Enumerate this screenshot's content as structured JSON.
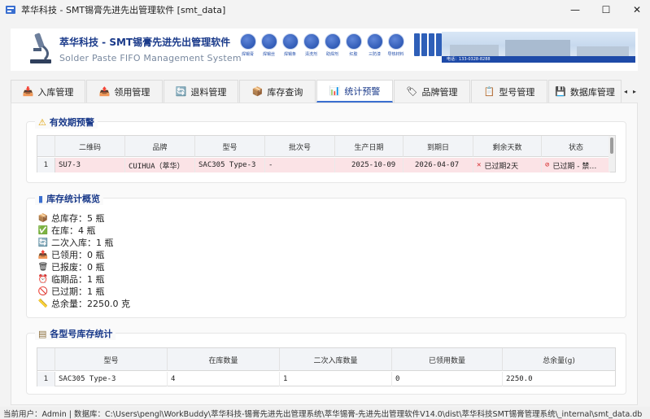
{
  "window": {
    "title": "萃华科技 - SMT锡膏先进先出管理软件 [smt_data]",
    "controls": {
      "minimize": "—",
      "maximize": "☐",
      "close": "✕"
    }
  },
  "header": {
    "title_cn": "萃华科技 - SMT锡膏先进先出管理软件",
    "title_en": "Solder Paste FIFO Management System",
    "products": [
      "焊锡膏",
      "焊锡丝",
      "焊锡条",
      "清洗剂",
      "助焊剂",
      "红胶",
      "三防漆",
      "导热材料"
    ],
    "ribbon_text": "电话：133-0328-8288"
  },
  "tabs": [
    {
      "label": "入库管理",
      "icon": "inbound-icon",
      "glyph": "📥"
    },
    {
      "label": "领用管理",
      "icon": "outbound-icon",
      "glyph": "📤"
    },
    {
      "label": "退料管理",
      "icon": "return-icon",
      "glyph": "🔄"
    },
    {
      "label": "库存查询",
      "icon": "box-icon",
      "glyph": "📦"
    },
    {
      "label": "统计预警",
      "icon": "chart-icon",
      "glyph": "📊"
    },
    {
      "label": "品牌管理",
      "icon": "tag-icon",
      "glyph": "🏷"
    },
    {
      "label": "型号管理",
      "icon": "document-icon",
      "glyph": "📋"
    },
    {
      "label": "数据库管理",
      "icon": "database-icon",
      "glyph": "💾"
    }
  ],
  "tab_scroll": {
    "left": "◂",
    "right": "▸"
  },
  "expiry_warning": {
    "title": "有效期预警",
    "icon": "warning-icon",
    "columns": [
      "二维码",
      "品牌",
      "型号",
      "批次号",
      "生产日期",
      "到期日",
      "剩余天数",
      "状态"
    ],
    "rows": [
      {
        "index": "1",
        "qrcode": "SU7-3",
        "brand": "CUIHUA（萃华）",
        "model": "SAC305 Type-3",
        "batch": "-",
        "production_date": "2025-10-09",
        "expiry_date": "2026-04-07",
        "remaining_days": "已过期2天",
        "remaining_icon": "x-icon",
        "status": "已过期 - 禁…",
        "status_icon": "prohibited-icon"
      }
    ]
  },
  "inventory_overview": {
    "title": "库存统计概览",
    "icon": "bar-chart-icon",
    "stats": [
      {
        "label": "总库存：5 瓶",
        "icon": "box-icon",
        "glyph": "📦"
      },
      {
        "label": "在库：4 瓶",
        "icon": "checkmark-icon",
        "glyph": "✅"
      },
      {
        "label": "二次入库：1 瓶",
        "icon": "cycle-icon",
        "glyph": "🔄"
      },
      {
        "label": "已领用：0 瓶",
        "icon": "outbound-icon",
        "glyph": "📤"
      },
      {
        "label": "已报废：0 瓶",
        "icon": "trash-icon",
        "glyph": "🗑"
      },
      {
        "label": "临期品：1 瓶",
        "icon": "alarm-clock-icon",
        "glyph": "⏰"
      },
      {
        "label": "已过期：1 瓶",
        "icon": "prohibited-icon",
        "glyph": "🚫"
      },
      {
        "label": "总余量：2250.0 克",
        "icon": "scale-icon",
        "glyph": "📏"
      }
    ]
  },
  "model_stats": {
    "title": "各型号库存统计",
    "icon": "clipboard-icon",
    "columns": [
      "型号",
      "在库数量",
      "二次入库数量",
      "已领用数量",
      "总余量(g)"
    ],
    "rows": [
      {
        "index": "1",
        "model": "SAC305 Type-3",
        "in_stock": "4",
        "re_entry": "1",
        "used": "0",
        "total": "2250.0"
      }
    ]
  },
  "statusbar": {
    "text": "当前用户：Admin | 数据库：C:\\Users\\pengl\\WorkBuddy\\萃华科技-锡膏先进先出管理系统\\萃华锡膏-先进先出管理软件V14.0\\dist\\萃华科技SMT锡膏管理系统\\_internal\\smt_data.db"
  }
}
